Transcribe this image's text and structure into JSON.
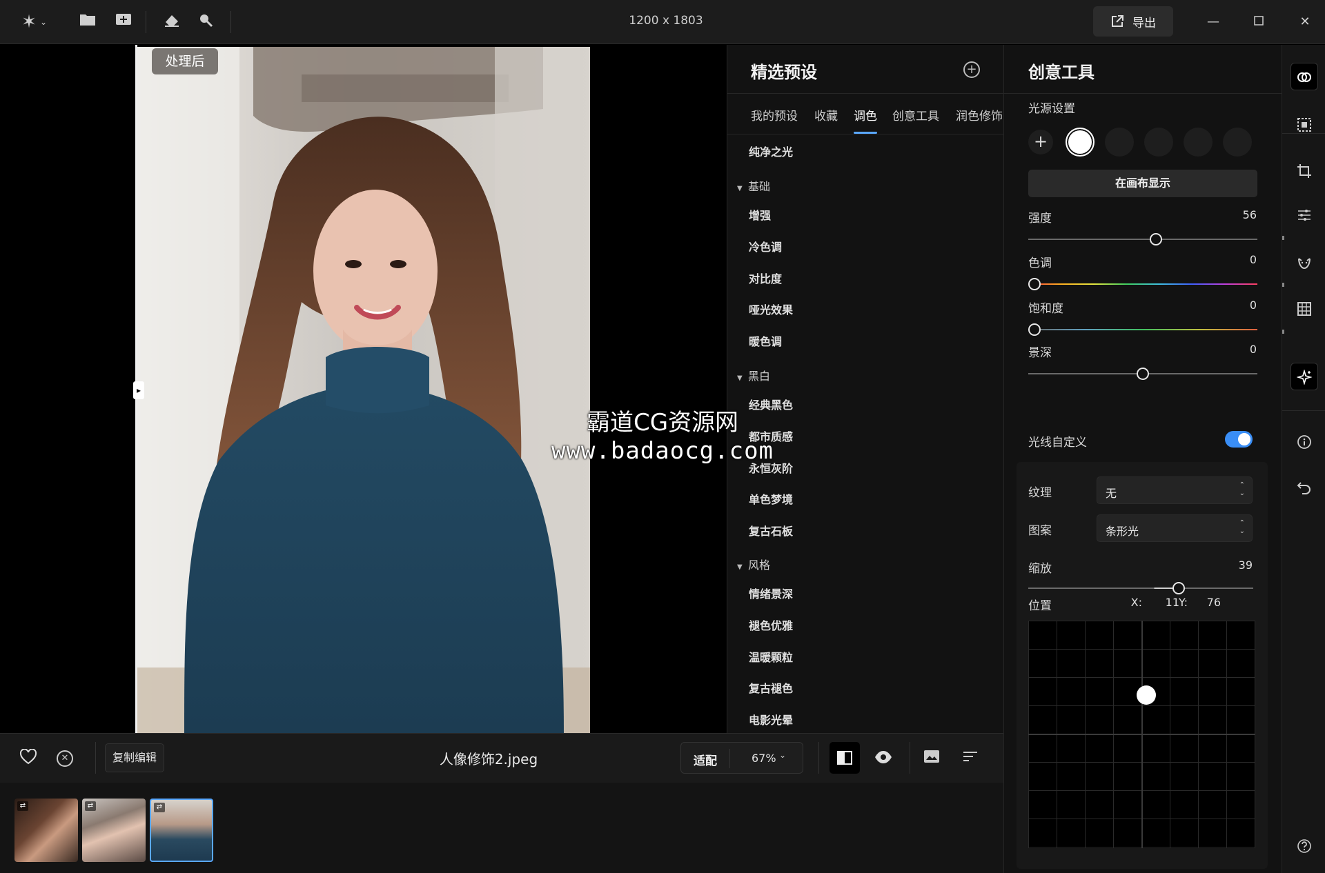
{
  "titlebar": {
    "dimensions": "1200 x 1803",
    "export_label": "导出"
  },
  "canvas": {
    "after_badge": "处理后"
  },
  "bottombar": {
    "copy_edit_label": "复制编辑",
    "filename": "人像修饰2.jpeg",
    "fit_label": "适配",
    "zoom": "67%"
  },
  "presets": {
    "title": "精选预设",
    "tabs": [
      {
        "label": "我的预设"
      },
      {
        "label": "收藏"
      },
      {
        "label": "调色",
        "active": true
      },
      {
        "label": "创意工具"
      },
      {
        "label": "润色修饰"
      }
    ],
    "top_item": "纯净之光",
    "groups": [
      {
        "name": "基础",
        "items": [
          "增强",
          "冷色调",
          "对比度",
          "哑光效果",
          "暖色调"
        ]
      },
      {
        "name": "黑白",
        "items": [
          "经典黑色",
          "都市质感",
          "永恒灰阶",
          "单色梦境",
          "复古石板"
        ]
      },
      {
        "name": "风格",
        "items": [
          "情绪景深",
          "褪色优雅",
          "温暖颗粒",
          "复古褪色",
          "电影光晕"
        ]
      }
    ]
  },
  "creative": {
    "title": "创意工具",
    "light_settings_label": "光源设置",
    "show_on_canvas_label": "在画布显示",
    "sliders": [
      {
        "label": "强度",
        "value": 56,
        "fraction": 0.56,
        "track": "plain"
      },
      {
        "label": "色调",
        "value": 0,
        "fraction": 0.0,
        "track": "hue"
      },
      {
        "label": "饱和度",
        "value": 0,
        "fraction": 0.0,
        "track": "sat"
      },
      {
        "label": "景深",
        "value": 0,
        "fraction": 0.5,
        "track": "plain"
      }
    ],
    "custom_light_label": "光线自定义",
    "custom_light_enabled": true,
    "texture_label": "纹理",
    "texture_value": "无",
    "pattern_label": "图案",
    "pattern_value": "条形光",
    "zoom_label": "缩放",
    "zoom_value": 39,
    "zoom_fraction": 0.68,
    "position_label": "位置",
    "pos_x_label": "X:",
    "pos_x_value": 11,
    "pos_y_label": "Y:",
    "pos_y_value": 76
  },
  "watermark": {
    "line1": "霸道CG资源网",
    "line2": "www.badaocg.com"
  },
  "colors": {
    "accent": "#3a8ef6",
    "tab_underline": "#5aa8ff",
    "panel_bg": "#121212",
    "titlebar_bg": "#1c1c1c"
  },
  "icons": {
    "app_menu": "sparkle-icon",
    "open": "folder-icon",
    "import": "add-image-icon",
    "erase": "eraser-icon",
    "search": "search-icon",
    "rail": [
      "blend-icon",
      "select-icon",
      "crop-icon",
      "sliders-icon",
      "face-icon",
      "grid-icon",
      "magic-icon",
      "info-icon",
      "undo-icon",
      "help-icon"
    ]
  }
}
